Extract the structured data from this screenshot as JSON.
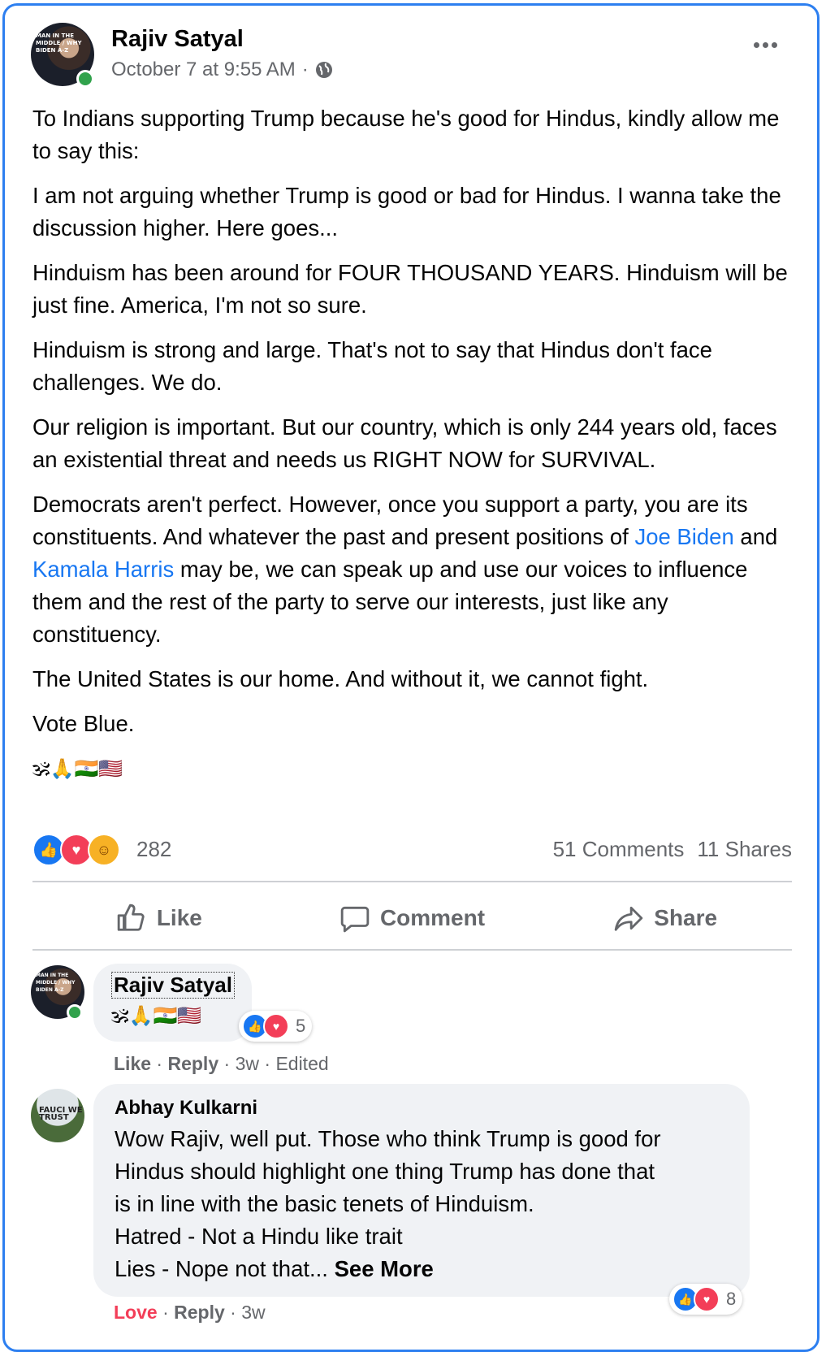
{
  "post": {
    "author": "Rajiv Satyal",
    "timestamp": "October 7 at 9:55 AM",
    "separator": "·",
    "privacy_icon": "globe-icon",
    "avatar_text": "MAN IN THE MIDDLE / WHY BIDEN A-Z",
    "paragraphs": [
      "To Indians supporting Trump because he's good for Hindus, kindly allow me to say this:",
      "I am not arguing whether Trump is good or bad for Hindus.  I wanna take the discussion higher.  Here goes...",
      "Hinduism has been around for FOUR THOUSAND YEARS.  Hinduism will be just fine.  America, I'm not so sure.",
      "Hinduism is strong and large.  That's not to say that Hindus don't face challenges.  We do.",
      "Our religion is important.  But our country, which is only 244 years old, faces an existential threat and needs us RIGHT NOW for SURVIVAL."
    ],
    "para6_pre": "Democrats aren't perfect.  However, once you support a party, you are its constituents.  And whatever the past and present positions of ",
    "link1": "Joe Biden",
    "para6_mid": " and ",
    "link2": "Kamala Harris",
    "para6_post": " may be, we can speak up and use our voices to influence them and the rest of the party to serve our interests, just like any constituency.",
    "para7": "The United States is our home.  And without it, we cannot fight.",
    "para8": "Vote Blue.",
    "emojis": "🕉🙏🇮🇳🇺🇸",
    "reaction_count": "282",
    "comments_count": "51 Comments",
    "shares_count": "11 Shares",
    "actions": {
      "like": "Like",
      "comment": "Comment",
      "share": "Share"
    }
  },
  "comments": [
    {
      "author": "Rajiv Satyal",
      "text": "🕉🙏🇮🇳🇺🇸",
      "reaction_count": "5",
      "action1": "Like",
      "action2": "Reply",
      "age": "3w",
      "edited": "Edited"
    },
    {
      "author": "Abhay Kulkarni",
      "avatar_text": "FAUCI WE TRUST",
      "lines": [
        "Wow Rajiv, well put. Those who think Trump is good for",
        "Hindus should highlight one thing Trump has done that",
        "is in line with the basic tenets of Hinduism.",
        "Hatred - Not a Hindu like trait"
      ],
      "last_line": "Lies - Nope not that... ",
      "see_more": "See More",
      "reaction_count": "8",
      "action1": "Love",
      "action2": "Reply",
      "age": "3w"
    }
  ]
}
